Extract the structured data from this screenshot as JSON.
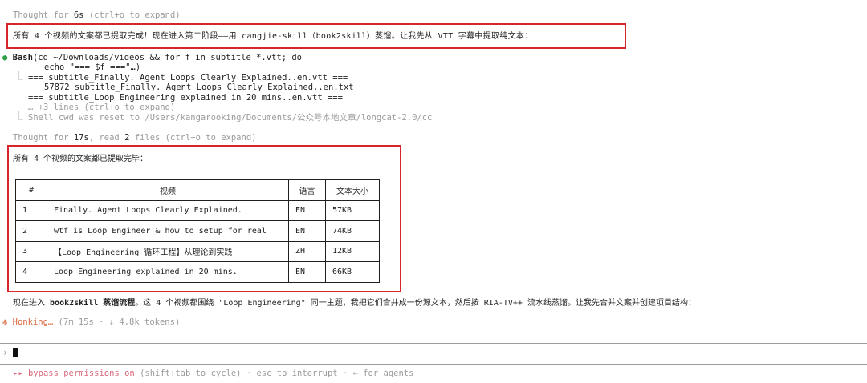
{
  "thought1": {
    "prefix": "Thought for ",
    "time": "6s",
    "suffix": " (ctrl+o to expand)"
  },
  "msg1": "所有 4 个视频的文案都已提取完成！现在进入第二阶段——用 cangjie-skill（book2skill）蒸馏。让我先从 VTT 字幕中提取纯文本：",
  "bash": {
    "tool": "Bash",
    "cmd_line1": "(cd ~/Downloads/videos && for f in subtitle_*.vtt; do",
    "cmd_line2": "echo \"=== $f ===\"…)",
    "out": [
      "=== subtitle_Finally. Agent Loops Clearly Explained..en.vtt ===",
      "57872 subtitle_Finally. Agent Loops Clearly Explained..en.txt",
      "=== subtitle_Loop Engineering explained in 20 mins..en.vtt ==="
    ],
    "more": "… +3 lines (ctrl+o to expand)",
    "cwd_reset": "Shell cwd was reset to /Users/kangarooking/Documents/公众号本地文章/longcat-2.0/cc"
  },
  "thought2": {
    "prefix": "Thought for ",
    "time": "17s",
    "mid": ", read ",
    "count": "2",
    "suffix": " files (ctrl+o to expand)"
  },
  "msg2": "所有 4 个视频的文案都已提取完毕：",
  "table": {
    "headers": [
      "#",
      "视频",
      "语言",
      "文本大小"
    ],
    "rows": [
      [
        "1",
        "Finally. Agent Loops Clearly Explained.",
        "EN",
        "57KB"
      ],
      [
        "2",
        "wtf is Loop Engineer & how to setup for real",
        "EN",
        "74KB"
      ],
      [
        "3",
        "【Loop Engineering 循环工程】从理论到实践",
        "ZH",
        "12KB"
      ],
      [
        "4",
        "Loop Engineering explained in 20 mins.",
        "EN",
        "66KB"
      ]
    ]
  },
  "msg3": {
    "a": "现在进入 ",
    "b": "book2skill 蒸馏流程",
    "c": "。这 4 个视频都围绕 \"Loop Engineering\" 同一主题，我把它们合并成一份源文本，然后按 RIA-TV++ 流水线蒸馏。让我先合并文案并创建项目结构："
  },
  "status": {
    "label": "Honking…",
    "detail": " (7m 15s · ↓ 4.8k tokens)"
  },
  "prompt_symbol": "›",
  "footer": {
    "arrows": "▸▸",
    "mode": "bypass permissions on",
    "hint": " (shift+tab to cycle) · esc to interrupt · ← for agents"
  },
  "colors": {
    "accent_red": "#d7262b",
    "status_orange": "#d9653b",
    "bullet_green": "#2e9e4a",
    "mode_pink": "#d9687a"
  }
}
